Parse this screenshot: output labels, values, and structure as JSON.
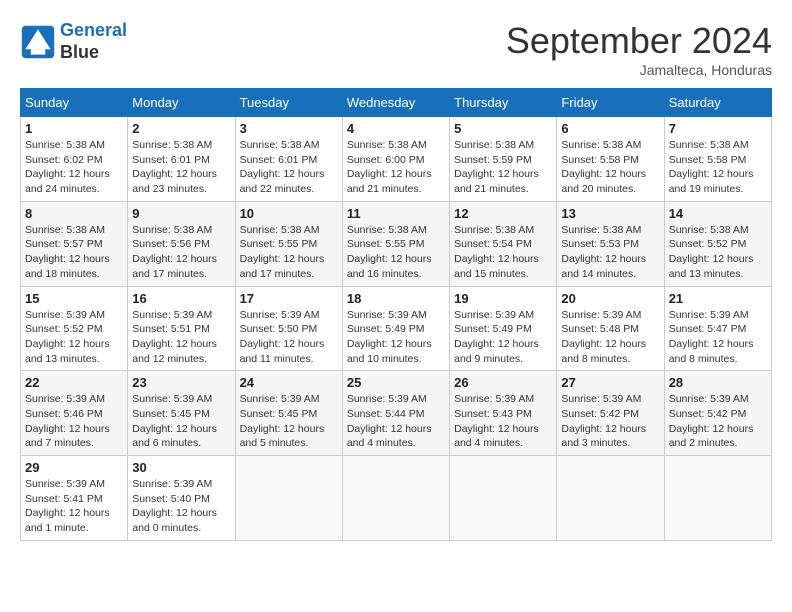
{
  "header": {
    "logo_line1": "General",
    "logo_line2": "Blue",
    "month_title": "September 2024",
    "location": "Jamalteca, Honduras"
  },
  "weekdays": [
    "Sunday",
    "Monday",
    "Tuesday",
    "Wednesday",
    "Thursday",
    "Friday",
    "Saturday"
  ],
  "weeks": [
    [
      {
        "day": "1",
        "info": "Sunrise: 5:38 AM\nSunset: 6:02 PM\nDaylight: 12 hours\nand 24 minutes."
      },
      {
        "day": "2",
        "info": "Sunrise: 5:38 AM\nSunset: 6:01 PM\nDaylight: 12 hours\nand 23 minutes."
      },
      {
        "day": "3",
        "info": "Sunrise: 5:38 AM\nSunset: 6:01 PM\nDaylight: 12 hours\nand 22 minutes."
      },
      {
        "day": "4",
        "info": "Sunrise: 5:38 AM\nSunset: 6:00 PM\nDaylight: 12 hours\nand 21 minutes."
      },
      {
        "day": "5",
        "info": "Sunrise: 5:38 AM\nSunset: 5:59 PM\nDaylight: 12 hours\nand 21 minutes."
      },
      {
        "day": "6",
        "info": "Sunrise: 5:38 AM\nSunset: 5:58 PM\nDaylight: 12 hours\nand 20 minutes."
      },
      {
        "day": "7",
        "info": "Sunrise: 5:38 AM\nSunset: 5:58 PM\nDaylight: 12 hours\nand 19 minutes."
      }
    ],
    [
      {
        "day": "8",
        "info": "Sunrise: 5:38 AM\nSunset: 5:57 PM\nDaylight: 12 hours\nand 18 minutes."
      },
      {
        "day": "9",
        "info": "Sunrise: 5:38 AM\nSunset: 5:56 PM\nDaylight: 12 hours\nand 17 minutes."
      },
      {
        "day": "10",
        "info": "Sunrise: 5:38 AM\nSunset: 5:55 PM\nDaylight: 12 hours\nand 17 minutes."
      },
      {
        "day": "11",
        "info": "Sunrise: 5:38 AM\nSunset: 5:55 PM\nDaylight: 12 hours\nand 16 minutes."
      },
      {
        "day": "12",
        "info": "Sunrise: 5:38 AM\nSunset: 5:54 PM\nDaylight: 12 hours\nand 15 minutes."
      },
      {
        "day": "13",
        "info": "Sunrise: 5:38 AM\nSunset: 5:53 PM\nDaylight: 12 hours\nand 14 minutes."
      },
      {
        "day": "14",
        "info": "Sunrise: 5:38 AM\nSunset: 5:52 PM\nDaylight: 12 hours\nand 13 minutes."
      }
    ],
    [
      {
        "day": "15",
        "info": "Sunrise: 5:39 AM\nSunset: 5:52 PM\nDaylight: 12 hours\nand 13 minutes."
      },
      {
        "day": "16",
        "info": "Sunrise: 5:39 AM\nSunset: 5:51 PM\nDaylight: 12 hours\nand 12 minutes."
      },
      {
        "day": "17",
        "info": "Sunrise: 5:39 AM\nSunset: 5:50 PM\nDaylight: 12 hours\nand 11 minutes."
      },
      {
        "day": "18",
        "info": "Sunrise: 5:39 AM\nSunset: 5:49 PM\nDaylight: 12 hours\nand 10 minutes."
      },
      {
        "day": "19",
        "info": "Sunrise: 5:39 AM\nSunset: 5:49 PM\nDaylight: 12 hours\nand 9 minutes."
      },
      {
        "day": "20",
        "info": "Sunrise: 5:39 AM\nSunset: 5:48 PM\nDaylight: 12 hours\nand 8 minutes."
      },
      {
        "day": "21",
        "info": "Sunrise: 5:39 AM\nSunset: 5:47 PM\nDaylight: 12 hours\nand 8 minutes."
      }
    ],
    [
      {
        "day": "22",
        "info": "Sunrise: 5:39 AM\nSunset: 5:46 PM\nDaylight: 12 hours\nand 7 minutes."
      },
      {
        "day": "23",
        "info": "Sunrise: 5:39 AM\nSunset: 5:45 PM\nDaylight: 12 hours\nand 6 minutes."
      },
      {
        "day": "24",
        "info": "Sunrise: 5:39 AM\nSunset: 5:45 PM\nDaylight: 12 hours\nand 5 minutes."
      },
      {
        "day": "25",
        "info": "Sunrise: 5:39 AM\nSunset: 5:44 PM\nDaylight: 12 hours\nand 4 minutes."
      },
      {
        "day": "26",
        "info": "Sunrise: 5:39 AM\nSunset: 5:43 PM\nDaylight: 12 hours\nand 4 minutes."
      },
      {
        "day": "27",
        "info": "Sunrise: 5:39 AM\nSunset: 5:42 PM\nDaylight: 12 hours\nand 3 minutes."
      },
      {
        "day": "28",
        "info": "Sunrise: 5:39 AM\nSunset: 5:42 PM\nDaylight: 12 hours\nand 2 minutes."
      }
    ],
    [
      {
        "day": "29",
        "info": "Sunrise: 5:39 AM\nSunset: 5:41 PM\nDaylight: 12 hours\nand 1 minute."
      },
      {
        "day": "30",
        "info": "Sunrise: 5:39 AM\nSunset: 5:40 PM\nDaylight: 12 hours\nand 0 minutes."
      },
      {
        "day": "",
        "info": ""
      },
      {
        "day": "",
        "info": ""
      },
      {
        "day": "",
        "info": ""
      },
      {
        "day": "",
        "info": ""
      },
      {
        "day": "",
        "info": ""
      }
    ]
  ]
}
